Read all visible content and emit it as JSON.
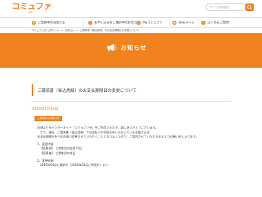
{
  "header": {
    "logo_text": "コミュファ",
    "logo_sub": "ctc",
    "search_placeholder": "サイト内を検索"
  },
  "nav": {
    "items": [
      {
        "label": "ご契約中のお客さま",
        "icon": "person-icon"
      },
      {
        "label": "お申し込みをご検討中のお客さま",
        "icon": "pencil-icon"
      },
      {
        "label": "Myコミュファ",
        "icon": "my-icon"
      },
      {
        "label": "Webメール",
        "icon": "mail-icon"
      },
      {
        "label": "よくあるご質問",
        "icon": "question-icon"
      }
    ]
  },
  "breadcrumb": {
    "items": [
      "コミュファ光 公式サイト",
      "お知らせ",
      "ご請求書（振込用紙）のお支払期限日の変更について"
    ],
    "separator": ">"
  },
  "banner": {
    "title": "お知らせ",
    "icon": "megaphone-icon"
  },
  "article": {
    "title": "ご請求書（振込用紙）のお支払期限日の変更について",
    "date": "2016年3月15日",
    "tag": "ご契約中のお客さま",
    "greeting": "日頃より光インターネット「コミュファ光」をご利用いただき、誠にありがとうございます。",
    "intro_1": "さて、現在、ご請求書（振込用紙）でお支払いの手続きをいただいているお客さまは、",
    "intro_2": "お支払期限日を下記の通り変更させていただくこととなりましたので、ご案内させていただきますようお願い申し上げます。",
    "section1_heading": "1．変更内容",
    "section1_line1": "【変更前】 ご請求月の翌月15日",
    "section1_line2": "【変更後】 ご請求月の末日",
    "section2_heading": "2．変更時期",
    "section2_line1": "2016年04月ご請求分（2016年03月ご利用分）より"
  },
  "colors": {
    "accent": "#f0831e"
  }
}
